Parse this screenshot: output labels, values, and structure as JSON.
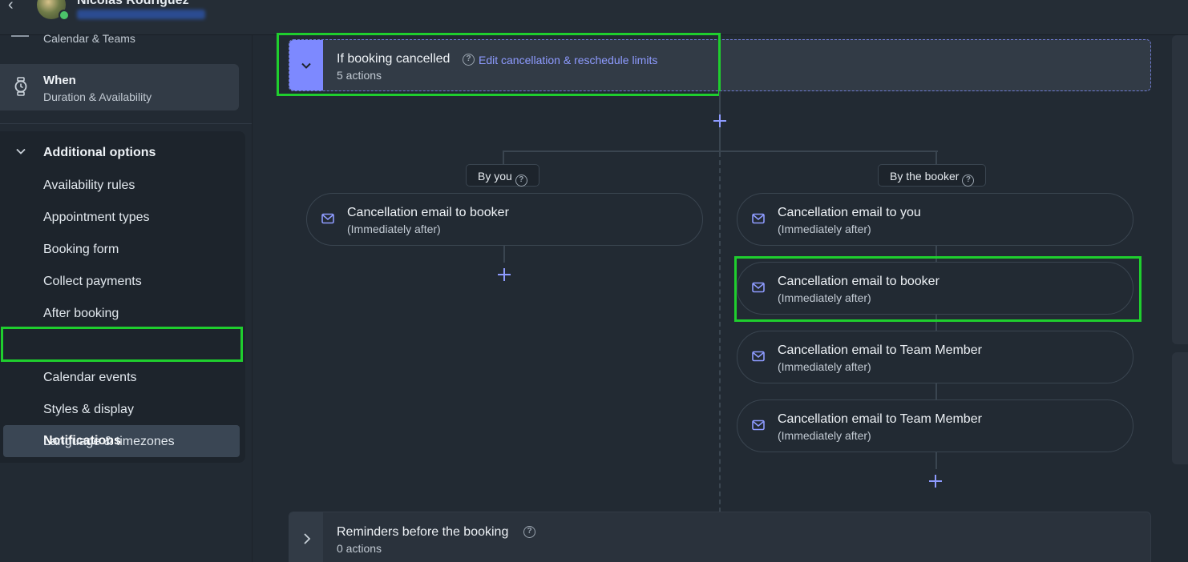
{
  "topbar": {
    "user_name": "Nicolas Rodriguez"
  },
  "sidebar": {
    "calendar_teams_sub": "Calendar & Teams",
    "when": {
      "title": "When",
      "sub": "Duration & Availability"
    },
    "additional": {
      "title": "Additional options",
      "items": [
        "Availability rules",
        "Appointment types",
        "Booking form",
        "Collect payments",
        "After booking",
        "Notifications",
        "Calendar events",
        "Styles & display",
        "Language & timezones"
      ],
      "active_index": 5
    }
  },
  "main": {
    "header": {
      "title": "If booking cancelled",
      "link": "Edit cancellation & reschedule limits",
      "sub": "5 actions"
    },
    "branches": {
      "left_label": "By you",
      "right_label": "By the booker"
    },
    "left_actions": [
      {
        "title": "Cancellation email to booker",
        "sub": "(Immediately after)"
      }
    ],
    "right_actions": [
      {
        "title": "Cancellation email to you",
        "sub": "(Immediately after)"
      },
      {
        "title": "Cancellation email to booker",
        "sub": "(Immediately after)"
      },
      {
        "title": "Cancellation email to Team Member",
        "sub": "(Immediately after)"
      },
      {
        "title": "Cancellation email to Team Member",
        "sub": "(Immediately after)"
      }
    ],
    "footer": {
      "title": "Reminders before the booking",
      "sub": "0 actions"
    }
  },
  "colors": {
    "accent": "#7d89ff",
    "link": "#8e9bff",
    "highlight": "#1fce2e",
    "background": "#222a33"
  }
}
